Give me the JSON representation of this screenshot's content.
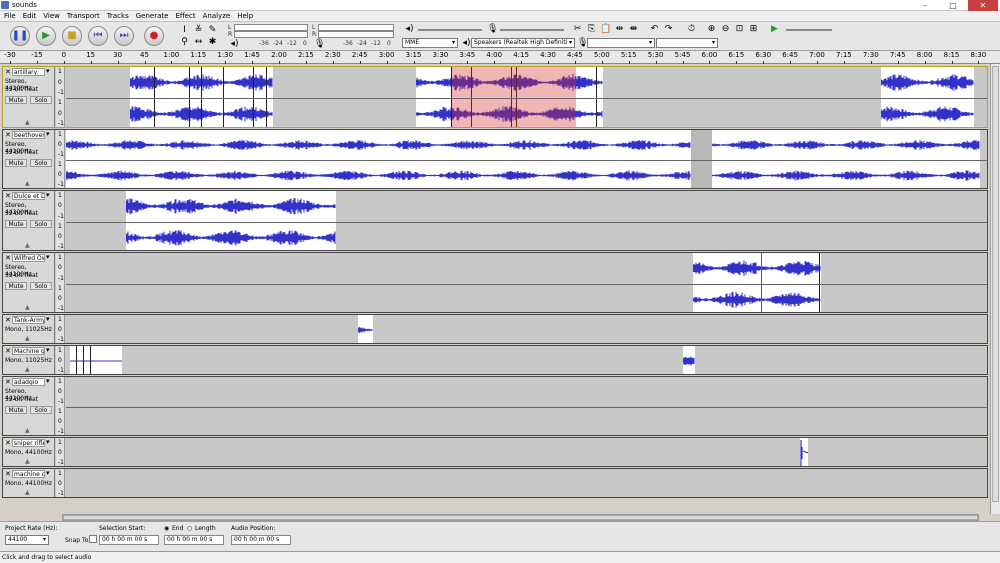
{
  "window": {
    "title": "sounds"
  },
  "menu": [
    "File",
    "Edit",
    "View",
    "Transport",
    "Tracks",
    "Generate",
    "Effect",
    "Analyze",
    "Help"
  ],
  "toolbar": {
    "meter_ticks": [
      "-36",
      "-24",
      "-12",
      "0"
    ],
    "host": "MME",
    "output_device": "Speakers (Realtek High Definiti",
    "input_device": "",
    "channels": "",
    "lr_labels": [
      "L",
      "R"
    ]
  },
  "ruler": {
    "ticks": [
      "-30",
      "-15",
      "0",
      "15",
      "30",
      "45",
      "1:00",
      "1:15",
      "1:30",
      "1:45",
      "2:00",
      "2:15",
      "2:30",
      "2:45",
      "3:00",
      "3:15",
      "3:30",
      "3:45",
      "4:00",
      "4:15",
      "4:30",
      "4:45",
      "5:00",
      "5:15",
      "5:30",
      "5:45",
      "6:00",
      "6:15",
      "6:30",
      "6:45",
      "7:00",
      "7:15",
      "7:30",
      "7:45",
      "8:00",
      "8:15",
      "8:30"
    ]
  },
  "tracks": [
    {
      "name": "artillary",
      "format": [
        "Stereo, 44100Hz",
        "32-bit float"
      ],
      "mute": "Mute",
      "solo": "Solo",
      "stereo": true,
      "selected": true
    },
    {
      "name": "beethoven",
      "format": [
        "Stereo, 44100Hz",
        "32-bit float"
      ],
      "mute": "Mute",
      "solo": "Solo",
      "stereo": true
    },
    {
      "name": "Dulce et De",
      "format": [
        "Stereo, 44100Hz",
        "32-bit float"
      ],
      "mute": "Mute",
      "solo": "Solo",
      "stereo": true
    },
    {
      "name": "Wilfred Ow",
      "format": [
        "Stereo, 44100Hz",
        "32-bit float"
      ],
      "mute": "Mute",
      "solo": "Solo",
      "stereo": true
    },
    {
      "name": "Tank-Army",
      "format": [
        "Mono, 11025Hz"
      ],
      "stereo": false
    },
    {
      "name": "Machine gu",
      "format": [
        "Mono, 11025Hz"
      ],
      "stereo": false
    },
    {
      "name": "adadgio",
      "format": [
        "Stereo, 44100Hz",
        "32-bit float"
      ],
      "mute": "Mute",
      "solo": "Solo",
      "stereo": true
    },
    {
      "name": "sniper rifle",
      "format": [
        "Mono, 44100Hz"
      ],
      "stereo": false
    },
    {
      "name": "machine gu",
      "format": [
        "Mono, 44100Hz"
      ],
      "stereo": false
    }
  ],
  "scale_labels": {
    "top": "1",
    "mid": "0",
    "bot": "-1"
  },
  "selection_bar": {
    "project_rate_label": "Project Rate (Hz):",
    "project_rate": "44100",
    "snap_label": "Snap To",
    "selection_start_label": "Selection Start:",
    "end_label": "End",
    "length_label": "Length",
    "audio_position_label": "Audio Position:",
    "time_value": "00 h 00 m 00 s"
  },
  "status": "Click and drag to select audio",
  "colors": {
    "waveform": "#3232c8",
    "selected_region": "#d42a2a",
    "background": "#d4d0c8"
  }
}
